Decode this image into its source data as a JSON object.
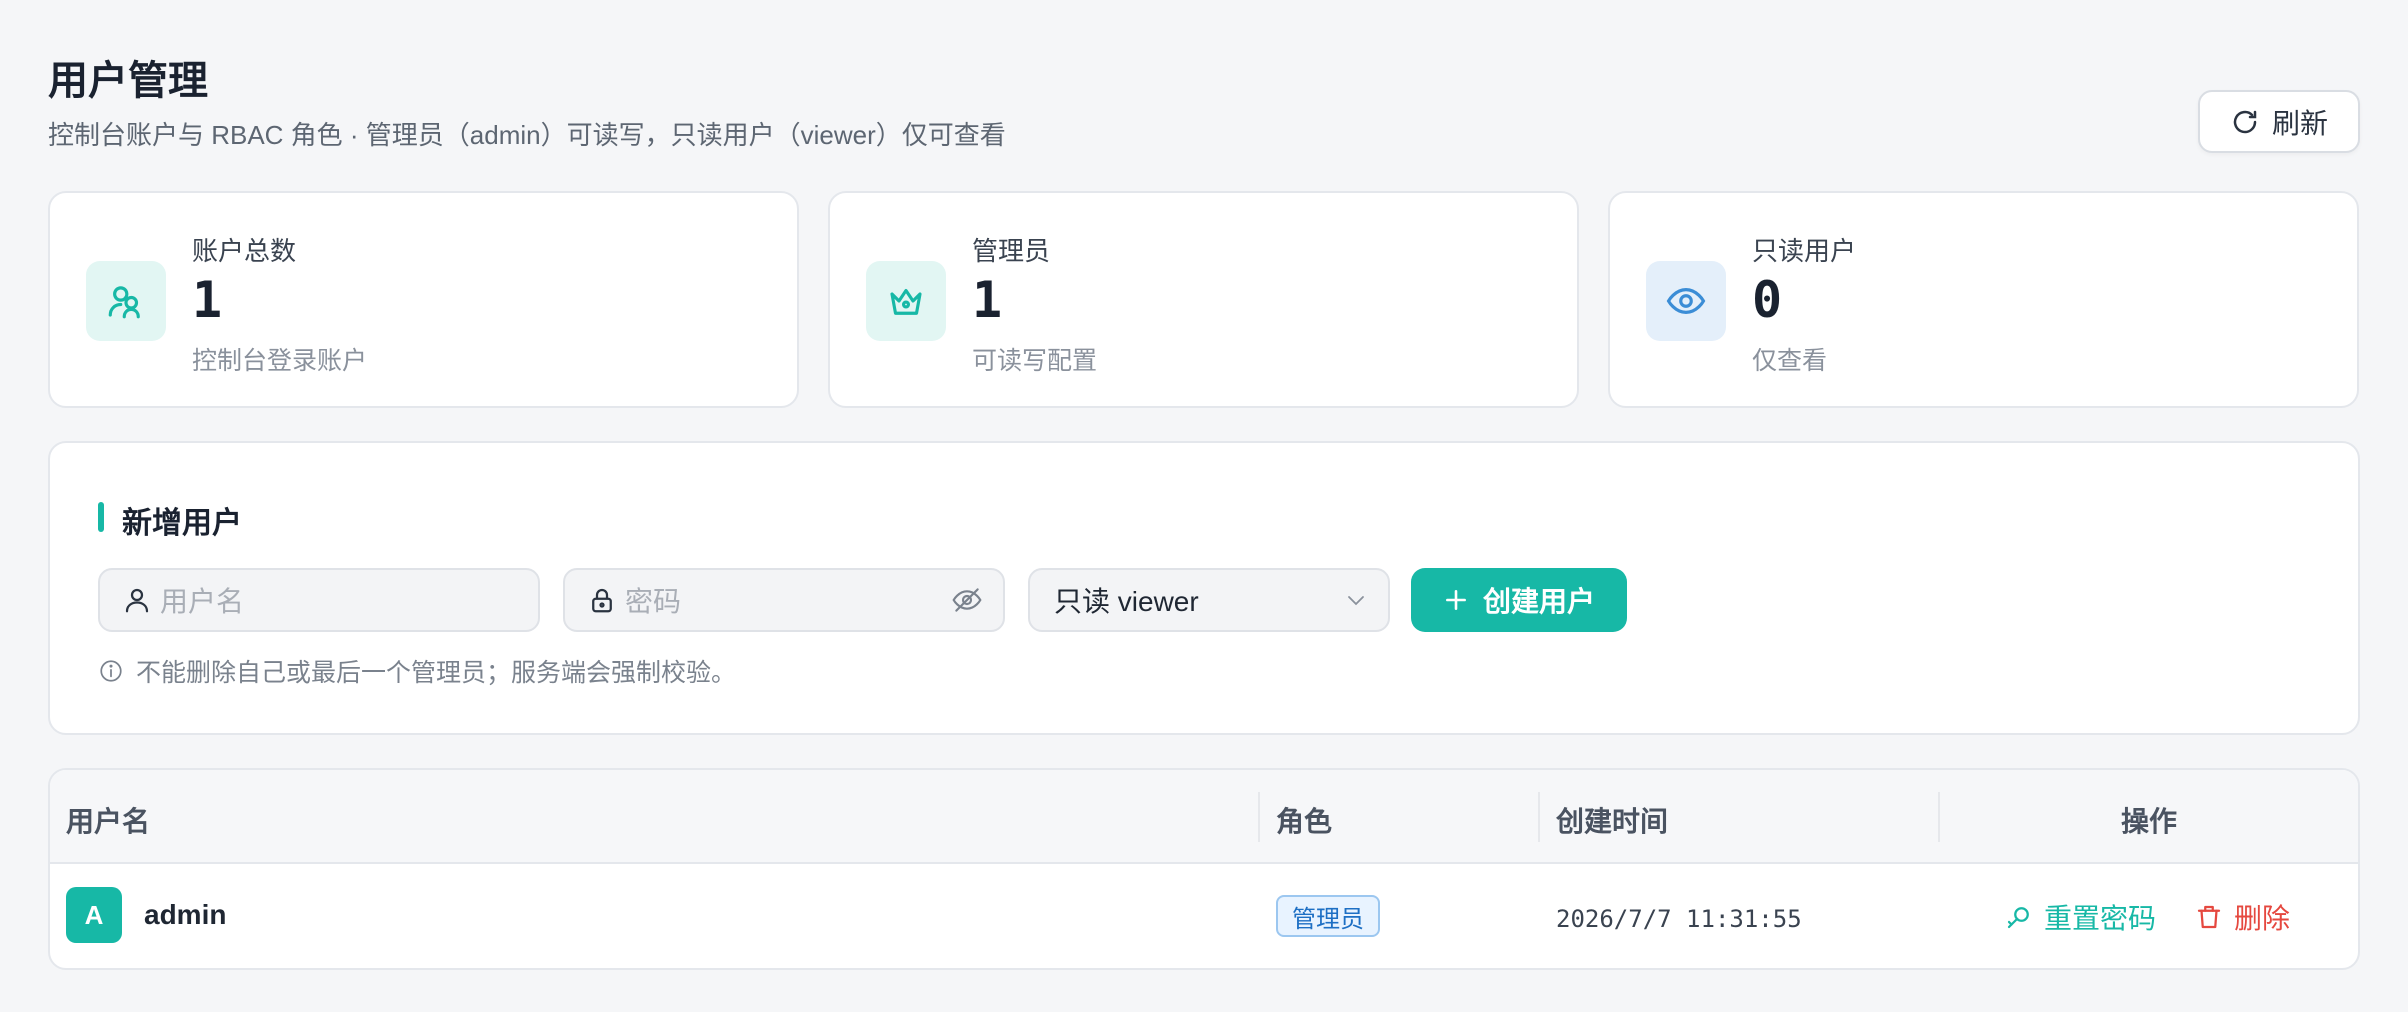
{
  "header": {
    "title": "用户管理",
    "subtitle": "控制台账户与 RBAC 角色 · 管理员（admin）可读写，只读用户（viewer）仅可查看",
    "refresh_label": "刷新"
  },
  "stats": [
    {
      "label": "账户总数",
      "value": "1",
      "desc": "控制台登录账户",
      "icon": "users-icon",
      "color": "#17b8a6"
    },
    {
      "label": "管理员",
      "value": "1",
      "desc": "可读写配置",
      "icon": "crown-icon",
      "color": "#17b8a6"
    },
    {
      "label": "只读用户",
      "value": "0",
      "desc": "仅查看",
      "icon": "eye-icon",
      "color": "#3b8dd6"
    }
  ],
  "new_user": {
    "title": "新增用户",
    "username_placeholder": "用户名",
    "password_placeholder": "密码",
    "role_value": "只读 viewer",
    "create_label": "创建用户",
    "hint": "不能删除自己或最后一个管理员；服务端会强制校验。"
  },
  "table": {
    "headers": {
      "username": "用户名",
      "role": "角色",
      "created": "创建时间",
      "actions": "操作"
    },
    "rows": [
      {
        "avatar": "A",
        "username": "admin",
        "role": "管理员",
        "created": "2026/7/7 11:31:55",
        "reset_label": "重置密码",
        "delete_label": "删除"
      }
    ]
  },
  "colors": {
    "accent": "#17b8a6",
    "danger": "#e5483f",
    "info": "#1d6fc4"
  }
}
